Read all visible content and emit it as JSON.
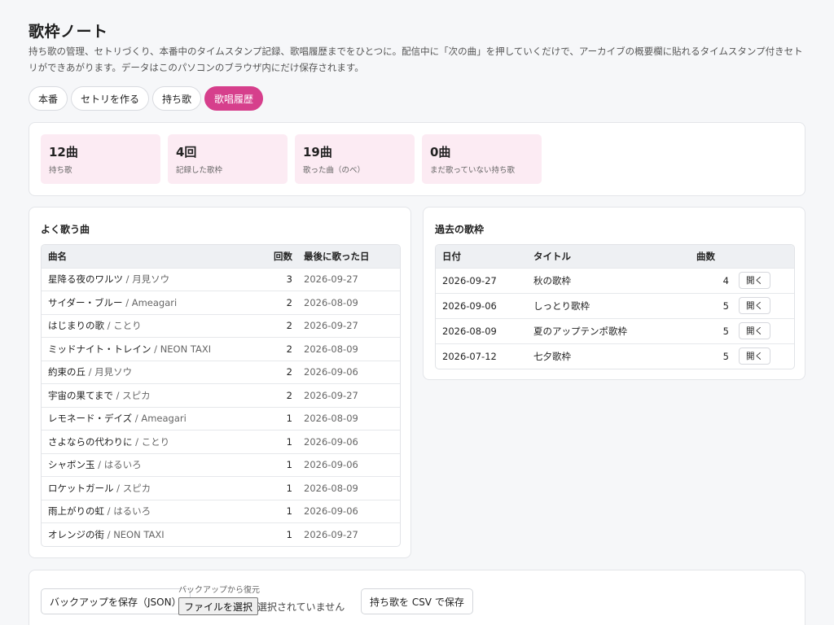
{
  "app": {
    "title": "歌枠ノート",
    "description": "持ち歌の管理、セトリづくり、本番中のタイムスタンプ記録、歌唱履歴までをひとつに。配信中に「次の曲」を押していくだけで、アーカイブの概要欄に貼れるタイムスタンプ付きセトリができあがります。データはこのパソコンのブラウザ内にだけ保存されます。"
  },
  "tabs": [
    {
      "label": "本番"
    },
    {
      "label": "セトリを作る"
    },
    {
      "label": "持ち歌"
    },
    {
      "label": "歌唱履歴",
      "active": true
    }
  ],
  "stats": [
    {
      "value": "12曲",
      "label": "持ち歌"
    },
    {
      "value": "4回",
      "label": "記録した歌枠"
    },
    {
      "value": "19曲",
      "label": "歌った曲（のべ）"
    },
    {
      "value": "0曲",
      "label": "まだ歌っていない持ち歌"
    }
  ],
  "frequent": {
    "title": "よく歌う曲",
    "headers": {
      "song": "曲名",
      "count": "回数",
      "last": "最後に歌った日"
    },
    "rows": [
      {
        "song": "星降る夜のワルツ",
        "artist": "月見ソウ",
        "count": "3",
        "last": "2026-09-27"
      },
      {
        "song": "サイダー・ブルー",
        "artist": "Ameagari",
        "count": "2",
        "last": "2026-08-09"
      },
      {
        "song": "はじまりの歌",
        "artist": "ことり",
        "count": "2",
        "last": "2026-09-27"
      },
      {
        "song": "ミッドナイト・トレイン",
        "artist": "NEON TAXI",
        "count": "2",
        "last": "2026-08-09"
      },
      {
        "song": "約束の丘",
        "artist": "月見ソウ",
        "count": "2",
        "last": "2026-09-06"
      },
      {
        "song": "宇宙の果てまで",
        "artist": "スピカ",
        "count": "2",
        "last": "2026-09-27"
      },
      {
        "song": "レモネード・デイズ",
        "artist": "Ameagari",
        "count": "1",
        "last": "2026-08-09"
      },
      {
        "song": "さよならの代わりに",
        "artist": "ことり",
        "count": "1",
        "last": "2026-09-06"
      },
      {
        "song": "シャボン玉",
        "artist": "はるいろ",
        "count": "1",
        "last": "2026-09-06"
      },
      {
        "song": "ロケットガール",
        "artist": "スピカ",
        "count": "1",
        "last": "2026-08-09"
      },
      {
        "song": "雨上がりの虹",
        "artist": "はるいろ",
        "count": "1",
        "last": "2026-09-06"
      },
      {
        "song": "オレンジの街",
        "artist": "NEON TAXI",
        "count": "1",
        "last": "2026-09-27"
      }
    ]
  },
  "history": {
    "title": "過去の歌枠",
    "headers": {
      "date": "日付",
      "title": "タイトル",
      "count": "曲数"
    },
    "open_label": "開く",
    "rows": [
      {
        "date": "2026-09-27",
        "title": "秋の歌枠",
        "count": "4"
      },
      {
        "date": "2026-09-06",
        "title": "しっとり歌枠",
        "count": "5"
      },
      {
        "date": "2026-08-09",
        "title": "夏のアップテンポ歌枠",
        "count": "5"
      },
      {
        "date": "2026-07-12",
        "title": "七夕歌枠",
        "count": "5"
      }
    ]
  },
  "backup": {
    "save_json_label": "バックアップを保存（JSON）",
    "restore_label": "バックアップから復元",
    "file_button_label": "ファイルを選択",
    "file_status": "選択されていません",
    "csv_label": "持ち歌を CSV で保存"
  },
  "colors": {
    "accent": "#d63f8c",
    "stat_bg": "#fcebf3",
    "page_bg": "#f6f7f9"
  }
}
